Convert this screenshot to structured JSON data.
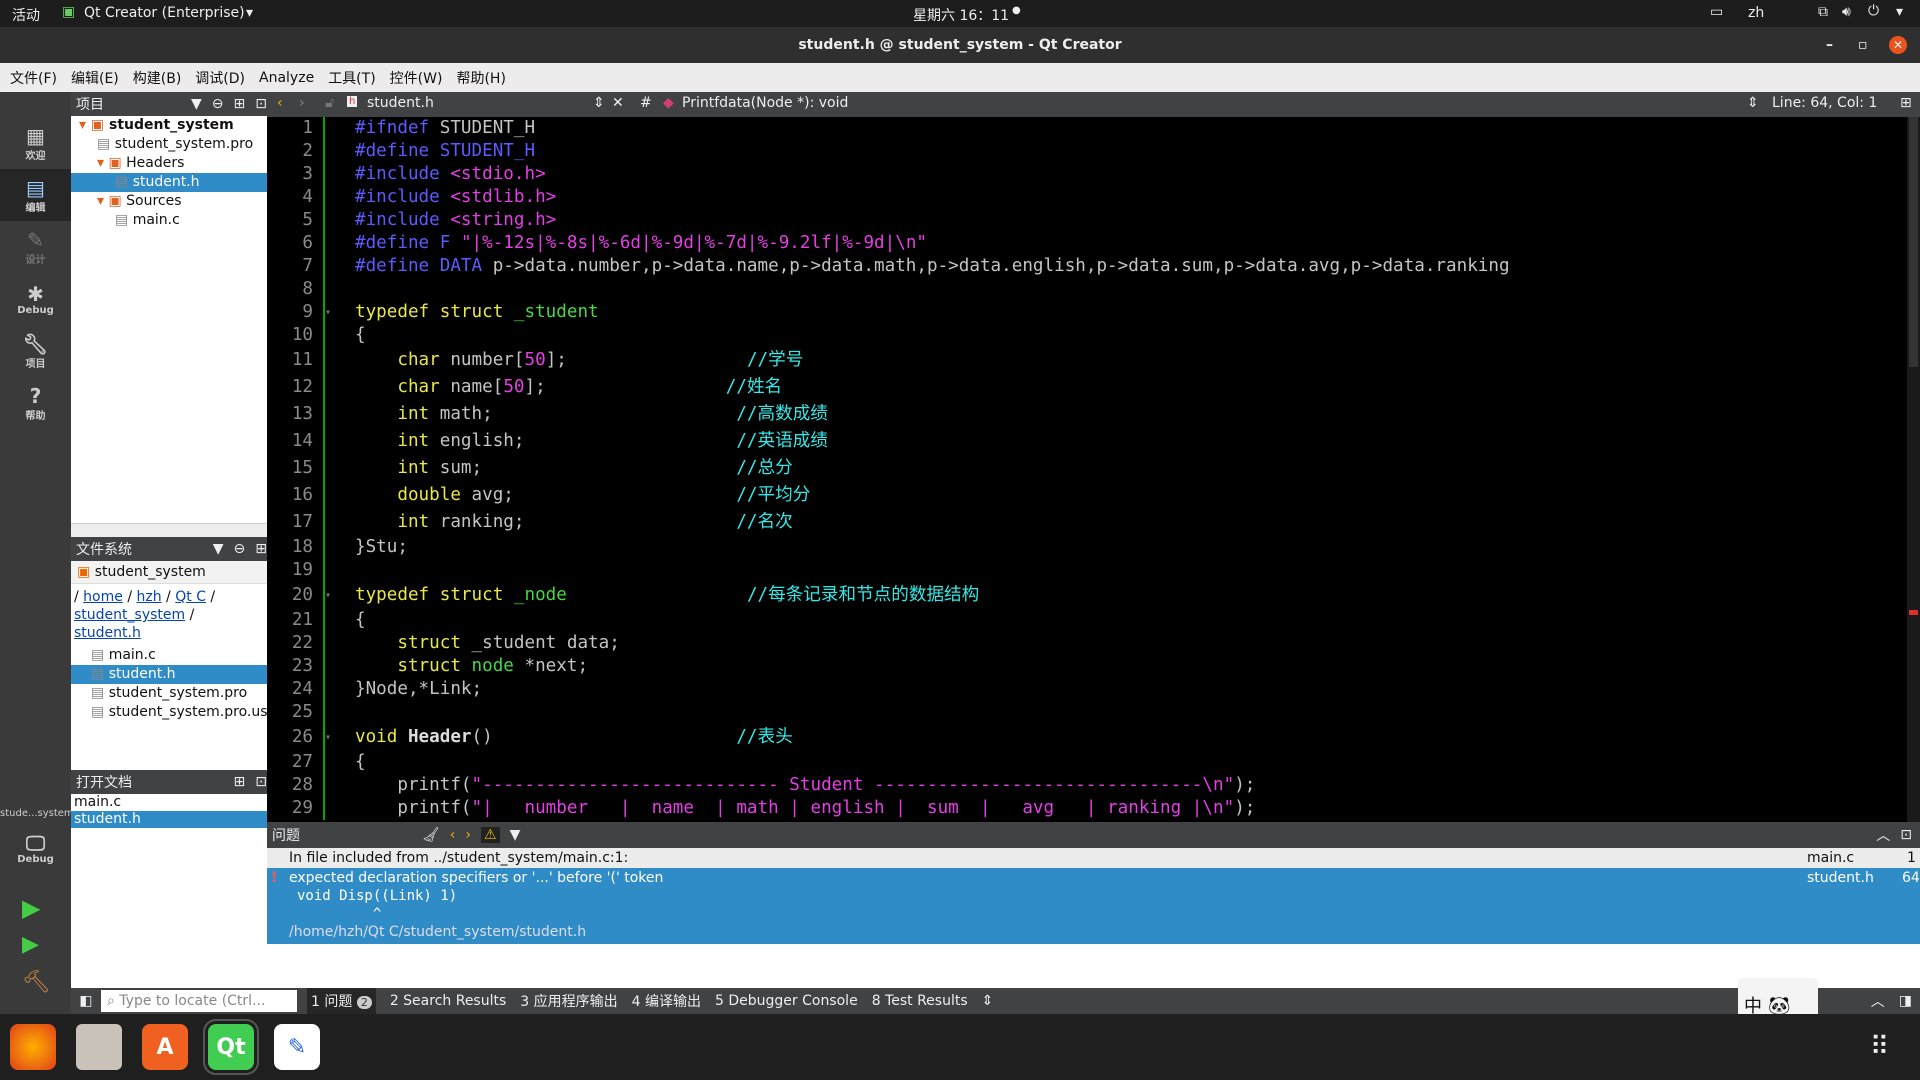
{
  "topbar": {
    "activities": "活动",
    "app": "Qt Creator (Enterprise)",
    "clock": "星期六 16：11",
    "lang": "zh"
  },
  "window": {
    "title": "student.h @ student_system - Qt Creator"
  },
  "menu": [
    "文件(F)",
    "编辑(E)",
    "构建(B)",
    "调试(D)",
    "Analyze",
    "工具(T)",
    "控件(W)",
    "帮助(H)"
  ],
  "modes": [
    {
      "label": "欢迎",
      "icon": "grid-icon"
    },
    {
      "label": "编辑",
      "icon": "edit-icon"
    },
    {
      "label": "设计",
      "icon": "pen-icon"
    },
    {
      "label": "Debug",
      "icon": "bug-icon"
    },
    {
      "label": "项目",
      "icon": "wrench-icon"
    },
    {
      "label": "帮助",
      "icon": "help-icon"
    }
  ],
  "kit": {
    "name": "stude...system",
    "mode": "Debug"
  },
  "projects": {
    "header": "项目",
    "items": [
      {
        "label": "student_system",
        "level": 0,
        "bold": true
      },
      {
        "label": "student_system.pro",
        "level": 1
      },
      {
        "label": "Headers",
        "level": 1
      },
      {
        "label": "student.h",
        "level": 2,
        "selected": true
      },
      {
        "label": "Sources",
        "level": 1
      },
      {
        "label": "main.c",
        "level": 2
      }
    ]
  },
  "filesystem": {
    "header": "文件系统",
    "combo": "student_system",
    "path": [
      "home",
      "hzh",
      "Qt C",
      "student_system",
      "student.h"
    ],
    "files": [
      {
        "label": "main.c"
      },
      {
        "label": "student.h",
        "selected": true
      },
      {
        "label": "student_system.pro"
      },
      {
        "label": "student_system.pro.user"
      }
    ]
  },
  "opendocs": {
    "header": "打开文档",
    "items": [
      {
        "label": "main.c"
      },
      {
        "label": "student.h",
        "selected": true
      }
    ]
  },
  "editor": {
    "file": "student.h",
    "hash": "#",
    "symbol": "Printfdata(Node *): void",
    "position": "Line: 64, Col: 1"
  },
  "code": [
    [
      [
        "pp",
        "#ifndef"
      ],
      [
        "id",
        " STUDENT_H"
      ]
    ],
    [
      [
        "pp",
        "#define STUDENT_H"
      ]
    ],
    [
      [
        "pp",
        "#include "
      ],
      [
        "str",
        "<stdio.h>"
      ]
    ],
    [
      [
        "pp",
        "#include "
      ],
      [
        "str",
        "<stdlib.h>"
      ]
    ],
    [
      [
        "pp",
        "#include "
      ],
      [
        "str",
        "<string.h>"
      ]
    ],
    [
      [
        "pp",
        "#define F "
      ],
      [
        "str",
        "\"|%-12s|%-8s|%-6d|%-9d|%-7d|%-9.2lf|%-9d|\\n\""
      ]
    ],
    [
      [
        "pp",
        "#define DATA "
      ],
      [
        "id",
        "p->data.number,p->data.name,p->data.math,p->data.english,p->data.sum,p->data.avg,p->data.ranking"
      ]
    ],
    [],
    [
      [
        "kw",
        "typedef struct "
      ],
      [
        "ty",
        "_student"
      ]
    ],
    [
      [
        "id",
        "{"
      ]
    ],
    [
      [
        "kw",
        "    char "
      ],
      [
        "id",
        "number["
      ],
      [
        "num",
        "50"
      ],
      [
        "id",
        "];                 "
      ],
      [
        "cm",
        "//学号"
      ]
    ],
    [
      [
        "kw",
        "    char "
      ],
      [
        "id",
        "name["
      ],
      [
        "num",
        "50"
      ],
      [
        "id",
        "];                 "
      ],
      [
        "cm",
        "//姓名"
      ]
    ],
    [
      [
        "kw",
        "    int "
      ],
      [
        "id",
        "math;                       "
      ],
      [
        "cm",
        "//高数成绩"
      ]
    ],
    [
      [
        "kw",
        "    int "
      ],
      [
        "id",
        "english;                    "
      ],
      [
        "cm",
        "//英语成绩"
      ]
    ],
    [
      [
        "kw",
        "    int "
      ],
      [
        "id",
        "sum;                        "
      ],
      [
        "cm",
        "//总分"
      ]
    ],
    [
      [
        "kw",
        "    double "
      ],
      [
        "id",
        "avg;                     "
      ],
      [
        "cm",
        "//平均分"
      ]
    ],
    [
      [
        "kw",
        "    int "
      ],
      [
        "id",
        "ranking;                    "
      ],
      [
        "cm",
        "//名次"
      ]
    ],
    [
      [
        "id",
        "}Stu;"
      ]
    ],
    [],
    [
      [
        "kw",
        "typedef struct "
      ],
      [
        "ty",
        "_node"
      ],
      [
        "id",
        "                 "
      ],
      [
        "cm",
        "//每条记录和节点的数据结构"
      ]
    ],
    [
      [
        "id",
        "{"
      ]
    ],
    [
      [
        "kw",
        "    struct "
      ],
      [
        "id",
        "_student data;"
      ]
    ],
    [
      [
        "kw",
        "    struct "
      ],
      [
        "ty",
        "node "
      ],
      [
        "id",
        "*next;"
      ]
    ],
    [
      [
        "id",
        "}Node,*Link;"
      ]
    ],
    [],
    [
      [
        "kw",
        "void "
      ],
      [
        "bold",
        "Header"
      ],
      [
        "id",
        "()                       "
      ],
      [
        "cm",
        "//表头"
      ]
    ],
    [
      [
        "id",
        "{"
      ]
    ],
    [
      [
        "id",
        "    printf("
      ],
      [
        "str",
        "\"---------------------------- Student -------------------------------\\n\""
      ],
      [
        "id",
        ");"
      ]
    ],
    [
      [
        "id",
        "    printf("
      ],
      [
        "str",
        "\"|   number   |  name  | math | english |  sum  |   avg   | ranking |\\n\""
      ],
      [
        "id",
        ");"
      ]
    ]
  ],
  "issues": {
    "header": "问题",
    "rows": [
      {
        "text": "In file included from ../student_system/main.c:1:",
        "file": "main.c",
        "line": "1"
      },
      {
        "text": "expected declaration specifiers or '...' before '(' token",
        "detail": [
          "void Disp((Link) 1)",
          "         ^"
        ],
        "path": "/home/hzh/Qt C/student_system/student.h",
        "file": "student.h",
        "line": "64"
      }
    ]
  },
  "statusbar": {
    "locator_placeholder": "Type to locate (Ctrl...",
    "tabs": [
      {
        "label": "1  问题",
        "badge": "2"
      },
      {
        "label": "2  Search Results"
      },
      {
        "label": "3  应用程序输出"
      },
      {
        "label": "4  编译输出"
      },
      {
        "label": "5  Debugger Console"
      },
      {
        "label": "8  Test Results"
      }
    ]
  },
  "ime": {
    "label": "中"
  },
  "dock": [
    {
      "name": "firefox",
      "label": ""
    },
    {
      "name": "files",
      "label": ""
    },
    {
      "name": "software",
      "label": "A"
    },
    {
      "name": "qt-creator",
      "label": "Qt"
    },
    {
      "name": "text-editor",
      "label": ""
    }
  ],
  "colors": {
    "selection": "#308cc6",
    "preprocessor": "#5b5bff",
    "keyword": "#e8e84a",
    "string": "#e43fe4",
    "comment": "#35e8e8",
    "type": "#46d846"
  }
}
